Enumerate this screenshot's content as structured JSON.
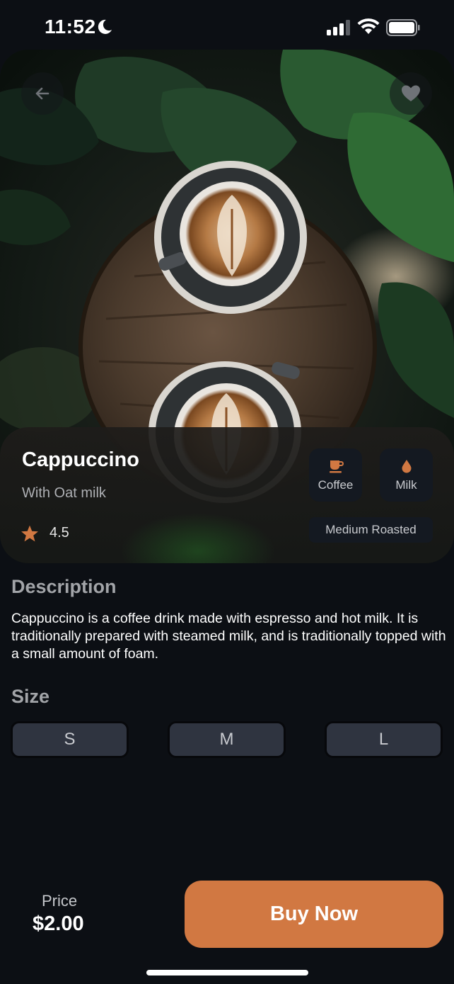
{
  "status_bar": {
    "time": "11:52",
    "icons": [
      "moon-icon",
      "signal-icon",
      "wifi-icon",
      "battery-icon"
    ]
  },
  "hero": {
    "image_description": "two cappuccinos with latte art on a wooden stool surrounded by monstera leaves",
    "back_icon": "arrow-left-icon",
    "favorite_icon": "heart-icon"
  },
  "product": {
    "name": "Cappuccino",
    "subtitle": "With Oat milk",
    "rating": "4.5",
    "chips": [
      {
        "icon": "coffee-cup-icon",
        "label": "Coffee"
      },
      {
        "icon": "milk-drop-icon",
        "label": "Milk"
      }
    ],
    "roast": "Medium Roasted"
  },
  "description": {
    "title": "Description",
    "text": "Cappuccino is a coffee drink made with espresso and hot milk. It is traditionally prepared with steamed milk, and is traditionally topped with a small amount of foam."
  },
  "size": {
    "title": "Size",
    "options": [
      "S",
      "M",
      "L"
    ]
  },
  "purchase": {
    "price_label": "Price",
    "price": "$2.00",
    "buy_label": "Buy Now"
  },
  "colors": {
    "background": "#0c0f14",
    "accent": "#d17842",
    "chip_bg": "#141921",
    "size_bg": "#2f3440"
  }
}
